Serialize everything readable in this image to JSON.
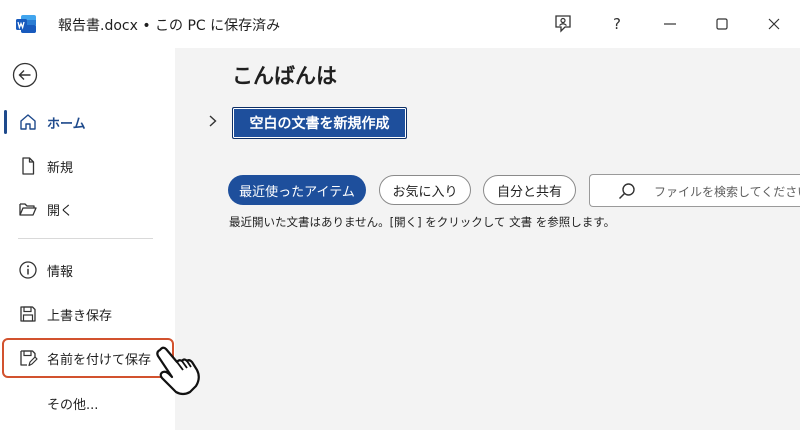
{
  "titlebar": {
    "doc_title": "報告書.docx • この PC に保存済み",
    "help_label": "?",
    "colors": {
      "word_blue": "#185abd"
    }
  },
  "sidebar": {
    "back": {
      "icon": "back-arrow-icon"
    },
    "items": [
      {
        "label": "ホーム",
        "icon": "home-icon",
        "active": true
      },
      {
        "label": "新規",
        "icon": "new-document-icon"
      },
      {
        "label": "開く",
        "icon": "open-folder-icon"
      },
      {
        "label": "情報",
        "icon": "info-icon"
      },
      {
        "label": "上書き保存",
        "icon": "save-icon"
      },
      {
        "label": "名前を付けて保存",
        "icon": "save-as-icon",
        "highlighted": true
      },
      {
        "label": "その他..."
      }
    ]
  },
  "main": {
    "greeting": "こんばんは",
    "new_blank_button": "空白の文書を新規作成",
    "filters": [
      "最近使ったアイテム",
      "お気に入り",
      "自分と共有"
    ],
    "search": {
      "placeholder": "ファイルを検索してください"
    },
    "empty_message": "最近開いた文書はありません。[開く] をクリックして 文書 を参照します。"
  },
  "colors": {
    "accent": "#1e4f9c",
    "highlight_border": "#d2522e"
  }
}
